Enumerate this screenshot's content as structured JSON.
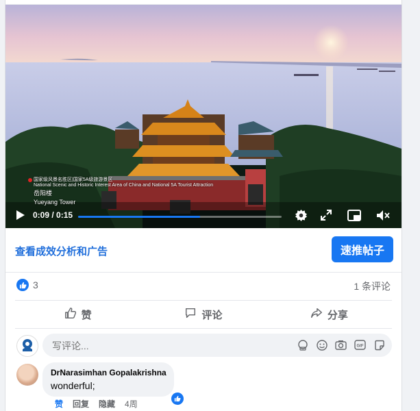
{
  "video": {
    "caption_line1": "国家级风景名胜区|国家5A级旅游景区",
    "caption_line2": "National Scenic and Historic Interest Area of China and National 5A Tourist Attraction",
    "place_cn": "岳阳楼",
    "place_en": "Yueyang Tower",
    "time": "0:09 / 0:15",
    "progress": 0.6,
    "icons": [
      "play-icon",
      "settings-icon",
      "fullscreen-icon",
      "pip-icon",
      "mute-icon"
    ]
  },
  "post_actions": {
    "insights": "查看成效分析和广告",
    "boost": "速推帖子"
  },
  "reactions": {
    "count": "3",
    "comments": "1 条评论"
  },
  "buttons": {
    "like": "赞",
    "comment": "评论",
    "share": "分享"
  },
  "composer": {
    "placeholder": "写评论...",
    "tools": [
      "avatar-sticker-icon",
      "emoji-icon",
      "camera-icon",
      "gif-icon",
      "sticker-icon"
    ]
  },
  "comment": {
    "author": "DrNarasimhan Gopalakrishna",
    "text": "wonderful;",
    "like": "赞",
    "reply": "回复",
    "hide": "隐藏",
    "time": "4周"
  },
  "colors": {
    "accent": "#1877f2",
    "link": "#216fdb",
    "secondary_text": "#65676b"
  }
}
